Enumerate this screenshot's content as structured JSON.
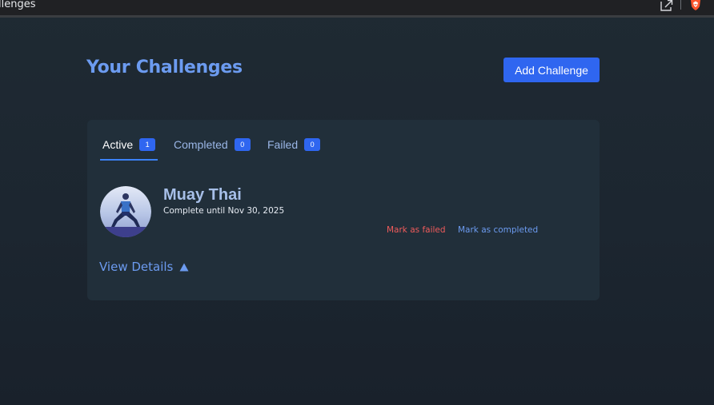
{
  "browser": {
    "tab_title": "llenges"
  },
  "header": {
    "title": "Your Challenges",
    "add_button_label": "Add Challenge"
  },
  "tabs": [
    {
      "label": "Active",
      "count": "1",
      "active": true
    },
    {
      "label": "Completed",
      "count": "0",
      "active": false
    },
    {
      "label": "Failed",
      "count": "0",
      "active": false
    }
  ],
  "challenge": {
    "name": "Muay Thai",
    "date_text": "Complete until Nov 30, 2025",
    "mark_failed_label": "Mark as failed",
    "mark_completed_label": "Mark as completed",
    "view_details_label": "View Details",
    "avatar_icon": "athlete-stretch-avatar"
  },
  "colors": {
    "accent": "#2f66f0",
    "title": "#6c9bf0",
    "danger": "#ef5b5b",
    "card_bg": "#212f3a",
    "page_bg": "#1f2a33"
  },
  "icons": [
    "share-icon",
    "brave-shield-icon",
    "chevron-up-icon"
  ]
}
